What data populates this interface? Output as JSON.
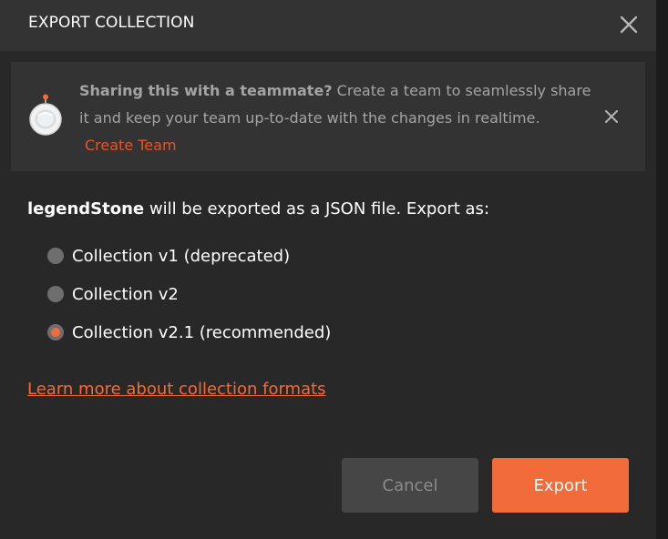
{
  "header": {
    "title": "EXPORT COLLECTION"
  },
  "banner": {
    "bold_text": "Sharing this with a teammate?",
    "body_text": " Create a team to seamlessly share it and keep your team up-to-date with the changes in realtime.",
    "link_label": "Create Team"
  },
  "export": {
    "collection_name": "legendStone",
    "description": " will be exported as a JSON file. Export as:",
    "options": [
      {
        "label": "Collection v1 (deprecated)",
        "selected": false
      },
      {
        "label": "Collection v2",
        "selected": false
      },
      {
        "label": "Collection v2.1 (recommended)",
        "selected": true
      }
    ],
    "learn_more_label": "Learn more about collection formats"
  },
  "footer": {
    "cancel_label": "Cancel",
    "export_label": "Export"
  },
  "colors": {
    "accent": "#f26b3a",
    "link": "#e5542b",
    "background": "#282828",
    "header_background": "#333333",
    "banner_background": "#333333",
    "cancel_background": "#464646"
  },
  "icons": {
    "close": "close-icon",
    "banner_close": "close-icon",
    "astronaut": "astronaut-icon"
  }
}
